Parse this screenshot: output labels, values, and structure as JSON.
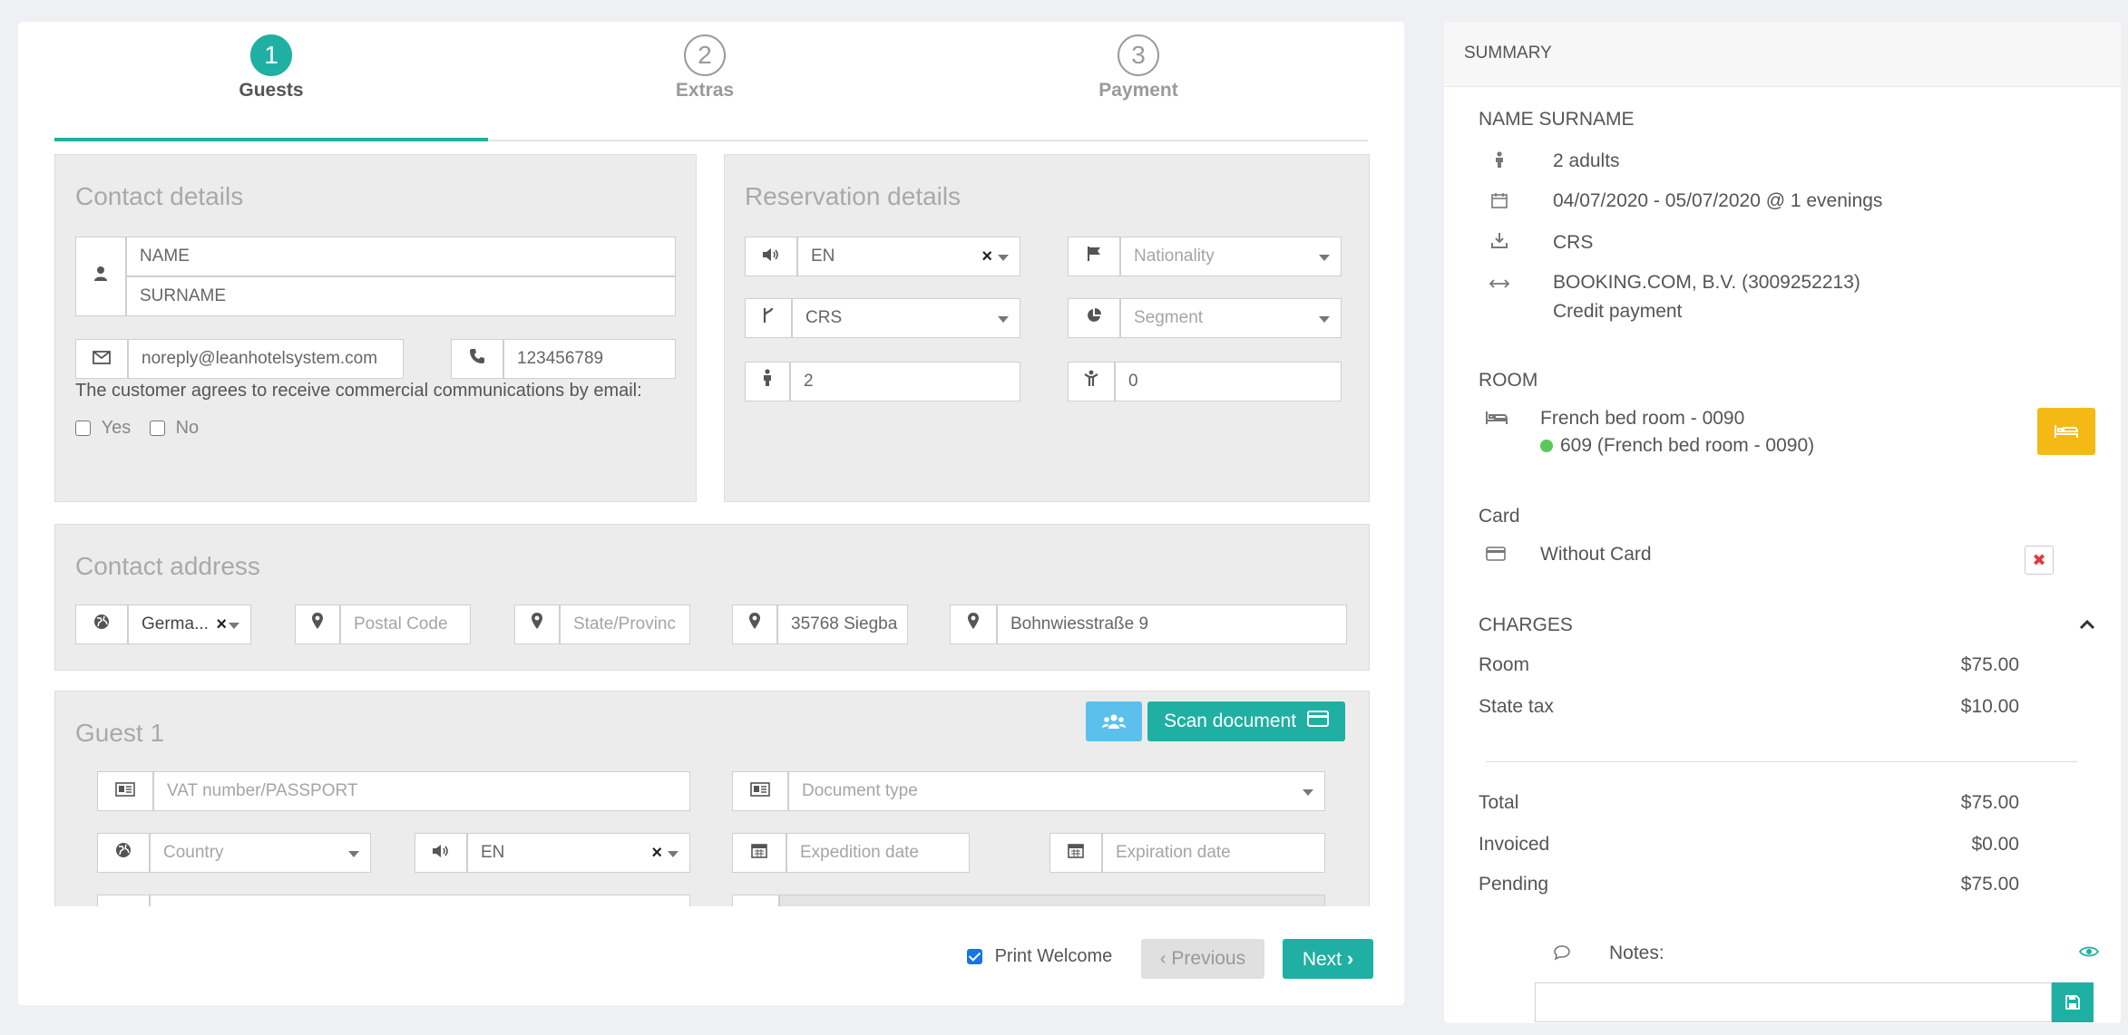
{
  "steps": [
    {
      "num": "1",
      "label": "Guests"
    },
    {
      "num": "2",
      "label": "Extras"
    },
    {
      "num": "3",
      "label": "Payment"
    }
  ],
  "contact": {
    "title": "Contact details",
    "name": "NAME",
    "surname": "SURNAME",
    "email": "noreply@leanhotelsystem.com",
    "phone": "123456789",
    "consent": "The customer agrees to receive commercial communications by email:",
    "yes": "Yes",
    "no": "No"
  },
  "reservation": {
    "title": "Reservation details",
    "language": "EN",
    "nationality_placeholder": "Nationality",
    "channel": "CRS",
    "segment_placeholder": "Segment",
    "adults": "2",
    "children": "0"
  },
  "address": {
    "title": "Contact address",
    "country": "Germa...",
    "postal_placeholder": "Postal Code",
    "state_placeholder": "State/Provinc",
    "city": "35768 Siegba",
    "street": "Bohnwiesstraße 9"
  },
  "guest": {
    "title": "Guest 1",
    "scan_label": "Scan document",
    "vat_placeholder": "VAT number/PASSPORT",
    "doctype_placeholder": "Document type",
    "country_placeholder": "Country",
    "language": "EN",
    "expedition_placeholder": "Expedition date",
    "expiration_placeholder": "Expiration date"
  },
  "footer": {
    "print_welcome": "Print Welcome",
    "previous": "Previous",
    "next": "Next"
  },
  "summary": {
    "header": "SUMMARY",
    "guest_name": "NAME SURNAME",
    "adults": "2 adults",
    "dates": "04/07/2020 - 05/07/2020 @ 1 evenings",
    "channel": "CRS",
    "agency": "BOOKING.COM, B.V. (3009252213)",
    "payment": "Credit payment",
    "room_title": "ROOM",
    "room_type": "French bed room - 0090",
    "room_assigned": "609 (French bed room - 0090)",
    "card_title": "Card",
    "card_value": "Without Card",
    "charges_title": "CHARGES",
    "charges": [
      {
        "label": "Room",
        "amount": "$75.00"
      },
      {
        "label": "State tax",
        "amount": "$10.00"
      }
    ],
    "totals": [
      {
        "label": "Total",
        "amount": "$75.00"
      },
      {
        "label": "Invoiced",
        "amount": "$0.00"
      },
      {
        "label": "Pending",
        "amount": "$75.00"
      }
    ],
    "notes_label": "Notes:"
  },
  "colors": {
    "accent": "#1fb0a3",
    "warning": "#f26b4a",
    "room_button": "#f5b915",
    "group_button": "#5bc0eb"
  }
}
